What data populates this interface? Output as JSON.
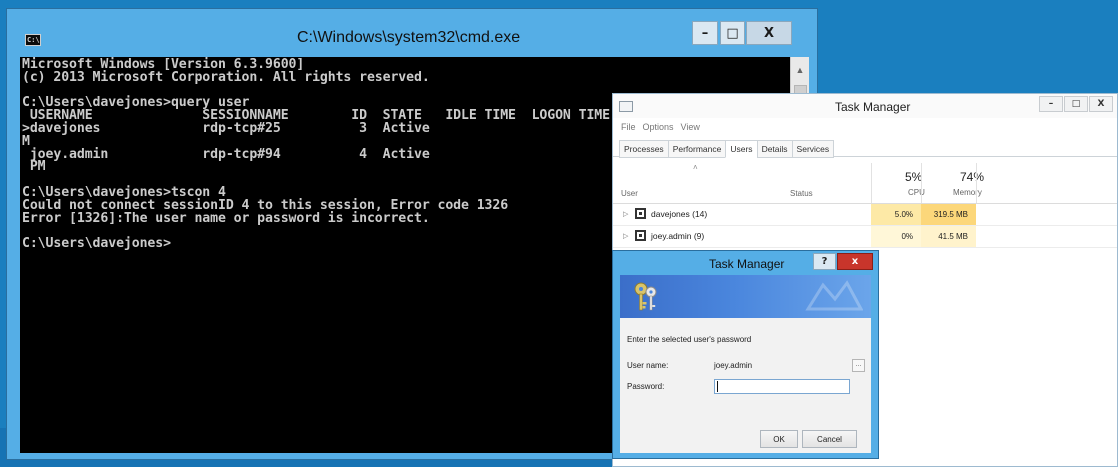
{
  "cmd": {
    "title": "C:\\Windows\\system32\\cmd.exe",
    "icon": "console-icon",
    "sysicon_label": "C:\\",
    "buttons": {
      "minimize": "–",
      "maximize": "□",
      "close": "X"
    },
    "console_lines": [
      "Microsoft Windows [Version 6.3.9600]",
      "(c) 2013 Microsoft Corporation. All rights reserved.",
      "",
      "C:\\Users\\davejones>query user",
      " USERNAME              SESSIONNAME        ID  STATE   IDLE TIME  LOGON TIME",
      ">davejones             rdp-tcp#25          3  Active",
      "M",
      " joey.admin            rdp-tcp#94          4  Active",
      " PM",
      "",
      "C:\\Users\\davejones>tscon 4",
      "Could not connect sessionID 4 to this session, Error code 1326",
      "Error [1326]:The user name or password is incorrect.",
      "",
      "C:\\Users\\davejones>"
    ],
    "scroll_up": "▲"
  },
  "taskmanager": {
    "title": "Task Manager",
    "window_buttons": {
      "minimize": "–",
      "maximize": "□",
      "close": "X"
    },
    "menu": [
      "File",
      "Options",
      "View"
    ],
    "tabs": [
      {
        "label": "Processes",
        "active": false
      },
      {
        "label": "Performance",
        "active": false
      },
      {
        "label": "Users",
        "active": true
      },
      {
        "label": "Details",
        "active": false
      },
      {
        "label": "Services",
        "active": false
      }
    ],
    "sort_indicator": "˄",
    "columns": {
      "user": "User",
      "status": "Status",
      "cpu_pct": "5%",
      "cpu": "CPU",
      "mem_pct": "74%",
      "mem": "Memory"
    },
    "expand_glyph": "▷",
    "rows": [
      {
        "user": "davejones (14)",
        "status": "",
        "cpu": "5.0%",
        "mem": "319.5 MB"
      },
      {
        "user": "joey.admin (9)",
        "status": "",
        "cpu": "0%",
        "mem": "41.5 MB"
      }
    ]
  },
  "dialog": {
    "title": "Task Manager",
    "help": "?",
    "close": "x",
    "prompt": "Enter the selected user's password",
    "user_label": "User name:",
    "user_value": "joey.admin",
    "browse": "...",
    "password_label": "Password:",
    "password_value": "",
    "ok": "OK",
    "cancel": "Cancel"
  }
}
